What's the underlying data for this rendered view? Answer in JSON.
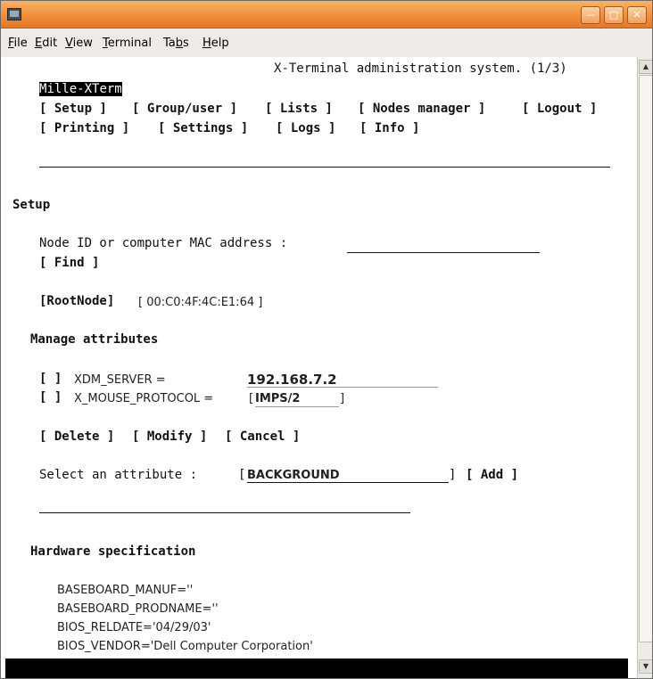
{
  "menu": {
    "items": [
      {
        "u": "F",
        "rest": "ile"
      },
      {
        "u": "E",
        "rest": "dit"
      },
      {
        "u": "V",
        "rest": "iew"
      },
      {
        "u": "T",
        "rest": "erminal"
      },
      {
        "pre": "Ta",
        "u": "b",
        "rest": "s"
      },
      {
        "u": "H",
        "rest": "elp"
      }
    ]
  },
  "header": {
    "system_title": "X-Terminal administration system. (1/3)",
    "app_first_char": "M",
    "app_rest": "ille-XTerm"
  },
  "nav": {
    "row1": [
      "[ Setup ]",
      "[ Group/user ]",
      "[ Lists ]",
      "[ Nodes manager ]",
      "[ Logout ]"
    ],
    "row2": [
      "[ Printing ]",
      "[ Settings ]",
      "[ Logs ]",
      "[ Info ]"
    ]
  },
  "setup": {
    "heading": "Setup",
    "node_label": "Node ID or computer MAC address :",
    "find_label": "[ Find ]",
    "root_node": "[RootNode]",
    "mac": "[ 00:C0:4F:4C:E1:64 ]"
  },
  "attributes": {
    "heading": "Manage attributes",
    "rows": [
      {
        "check": "[ ]",
        "name": "XDM_SERVER =",
        "value": "192.168.7.2"
      },
      {
        "check": "[ ]",
        "name": "X_MOUSE_PROTOCOL =",
        "value": "IMPS/2"
      }
    ],
    "x_mouse_bracket_open": "[",
    "x_mouse_bracket_close": "]",
    "delete_label": "[ Delete ]",
    "modify_label": "[ Modify ]",
    "cancel_label": "[ Cancel ]",
    "select_label": "Select an attribute :",
    "select_open": "[",
    "select_value": "BACKGROUND",
    "select_close": "]",
    "add_label": "[ Add ]"
  },
  "hardware": {
    "heading": "Hardware specification",
    "lines": [
      "BASEBOARD_MANUF=''",
      "BASEBOARD_PRODNAME=''",
      "BIOS_RELDATE='04/29/03'",
      "BIOS_VENDOR='Dell Computer Corporation'"
    ]
  },
  "icons": {
    "minimize": "minimize-icon",
    "maximize": "maximize-icon",
    "close": "close-icon",
    "scroll_up": "arrow-up-icon",
    "scroll_down": "arrow-down-icon"
  }
}
